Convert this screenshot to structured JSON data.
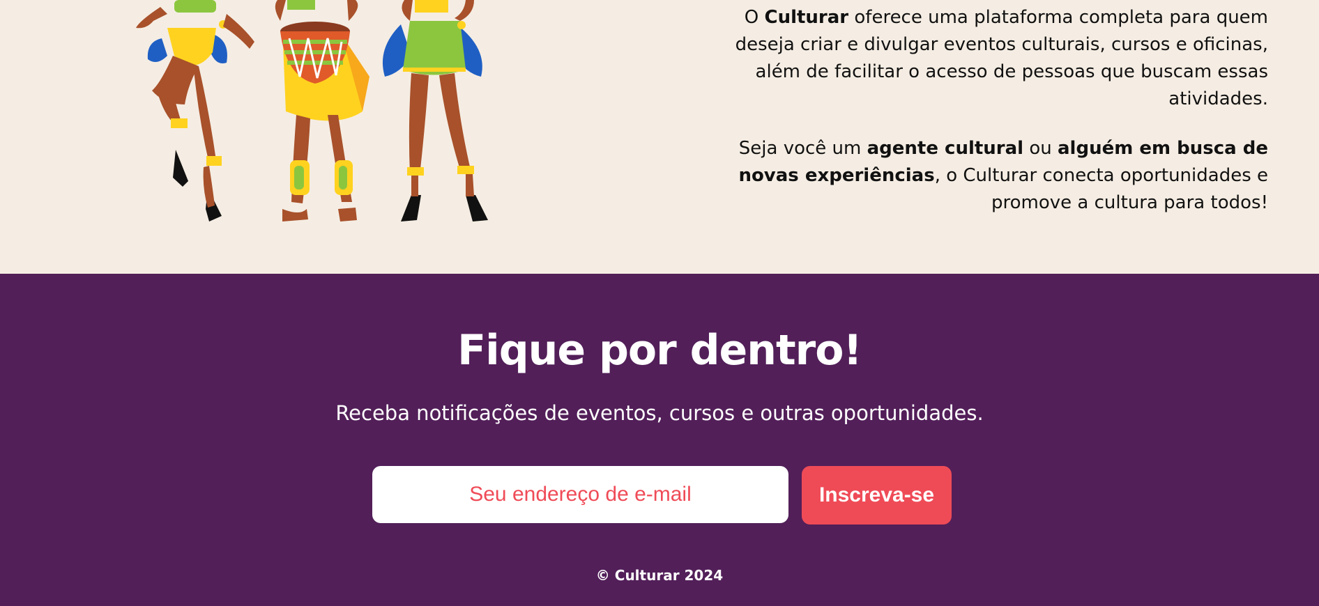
{
  "about": {
    "p1_prefix": "O ",
    "p1_brand": "Culturar",
    "p1_rest": " oferece uma plataforma completa para quem deseja criar e divulgar eventos culturais, cursos e oficinas, além de facilitar o acesso de pessoas que buscam essas atividades.",
    "p2_prefix": "Seja você um ",
    "p2_bold1": "agente cultural",
    "p2_mid": " ou ",
    "p2_bold2": "alguém em busca de novas experiências",
    "p2_rest": ", o Culturar conecta oportunidades e promove a cultura para todos!"
  },
  "newsletter": {
    "title": "Fique por dentro!",
    "subtitle": "Receba notificações de eventos, cursos e outras oportunidades.",
    "email_placeholder": "Seu endereço de e-mail",
    "button_label": "Inscreva-se"
  },
  "footer": {
    "copyright": "© Culturar 2024"
  },
  "colors": {
    "background": "#f5ede3",
    "purple": "#521f59",
    "accent_red": "#ef4b57"
  }
}
